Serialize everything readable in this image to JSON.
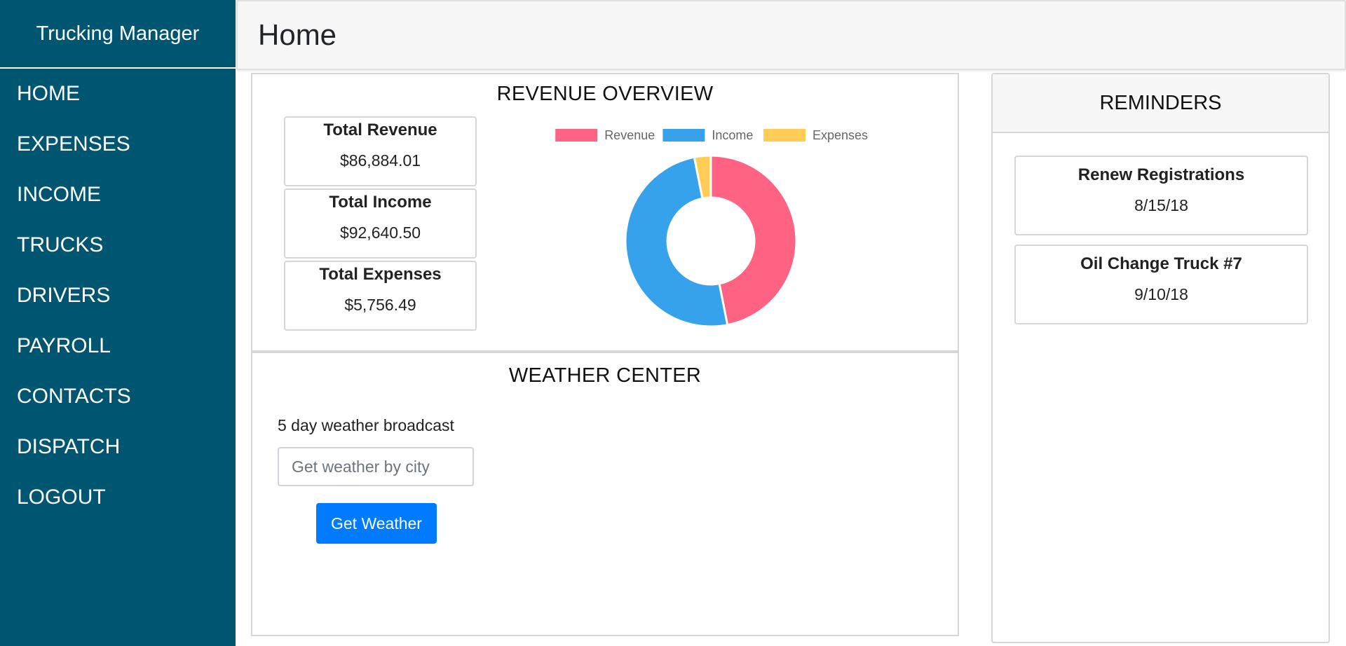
{
  "app": {
    "brand": "Trucking Manager"
  },
  "sidebar": {
    "items": [
      {
        "label": "HOME"
      },
      {
        "label": "EXPENSES"
      },
      {
        "label": "INCOME"
      },
      {
        "label": "TRUCKS"
      },
      {
        "label": "DRIVERS"
      },
      {
        "label": "PAYROLL"
      },
      {
        "label": "CONTACTS"
      },
      {
        "label": "DISPATCH"
      },
      {
        "label": "LOGOUT"
      }
    ]
  },
  "header": {
    "title": "Home"
  },
  "revenue": {
    "title": "REVENUE OVERVIEW",
    "cards": [
      {
        "label": "Total Revenue",
        "value": "$86,884.01"
      },
      {
        "label": "Total Income",
        "value": "$92,640.50"
      },
      {
        "label": "Total Expenses",
        "value": "$5,756.49"
      }
    ]
  },
  "chart_data": {
    "type": "pie",
    "variant": "doughnut",
    "categories": [
      "Revenue",
      "Income",
      "Expenses"
    ],
    "values": [
      86884.01,
      92640.5,
      5756.49
    ],
    "colors": [
      "#ff6384",
      "#36a2eb",
      "#ffcd56"
    ],
    "legend": "top"
  },
  "weather": {
    "title": "WEATHER CENTER",
    "label": "5 day weather broadcast",
    "input_placeholder": "Get weather by city",
    "input_value": "",
    "button_label": "Get Weather"
  },
  "reminders": {
    "title": "REMINDERS",
    "items": [
      {
        "title": "Renew Registrations",
        "date": "8/15/18"
      },
      {
        "title": "Oil Change Truck #7",
        "date": "9/10/18"
      }
    ]
  }
}
